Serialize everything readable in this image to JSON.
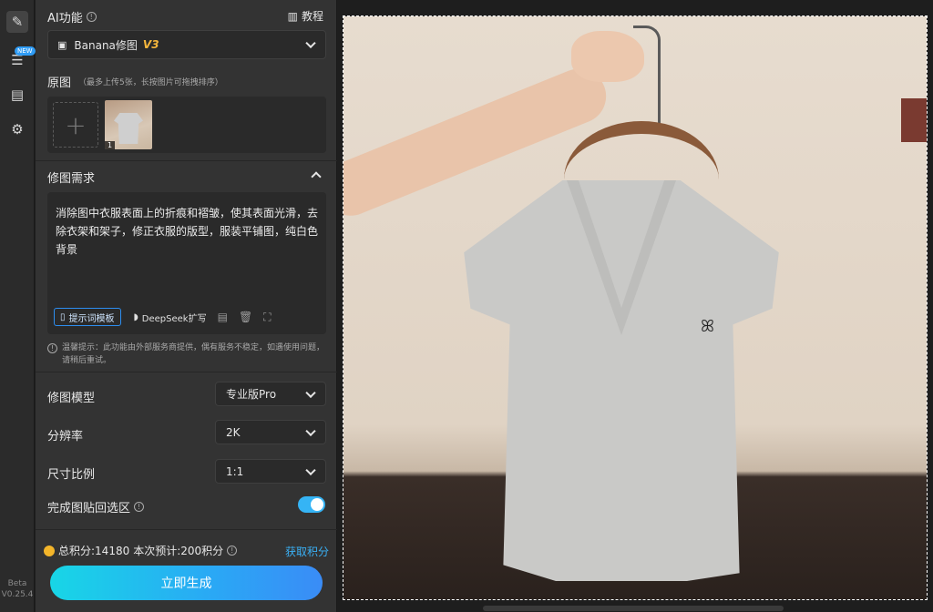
{
  "rail": {
    "new_badge": "NEW",
    "version_line1": "Beta",
    "version_line2": "V0.25.4"
  },
  "panel": {
    "ai_title": "AI功能",
    "tutorial_label": "教程",
    "model": {
      "name": "Banana修图",
      "version": "V3"
    },
    "original": {
      "title": "原图",
      "hint": "（最多上传5张，长按图片可拖拽排序）",
      "thumb_index": "1"
    },
    "requirement": {
      "title": "修图需求",
      "text": "消除图中衣服表面上的折痕和褶皱，使其表面光滑，去除衣架和架子，修正衣服的版型，服装平铺图，纯白色背景",
      "template_button": "提示词模板",
      "deepseek_button": "DeepSeek扩写"
    },
    "tip": "温馨提示：此功能由外部服务商提供，偶有服务不稳定，如遇使用问题，请稍后重试。",
    "settings": {
      "model_label": "修图模型",
      "model_value": "专业版Pro",
      "resolution_label": "分辨率",
      "resolution_value": "2K",
      "ratio_label": "尺寸比例",
      "ratio_value": "1:1",
      "paste_back_label": "完成图贴回选区",
      "paste_back_on": true
    },
    "points": {
      "total": "总积分:14180",
      "estimate": "本次预计:200积分",
      "get_link": "获取积分"
    },
    "generate_button": "立即生成"
  },
  "colors": {
    "accent": "#2aa8f5",
    "badge": "#f6b73c",
    "toggle": "#35b4f5"
  }
}
